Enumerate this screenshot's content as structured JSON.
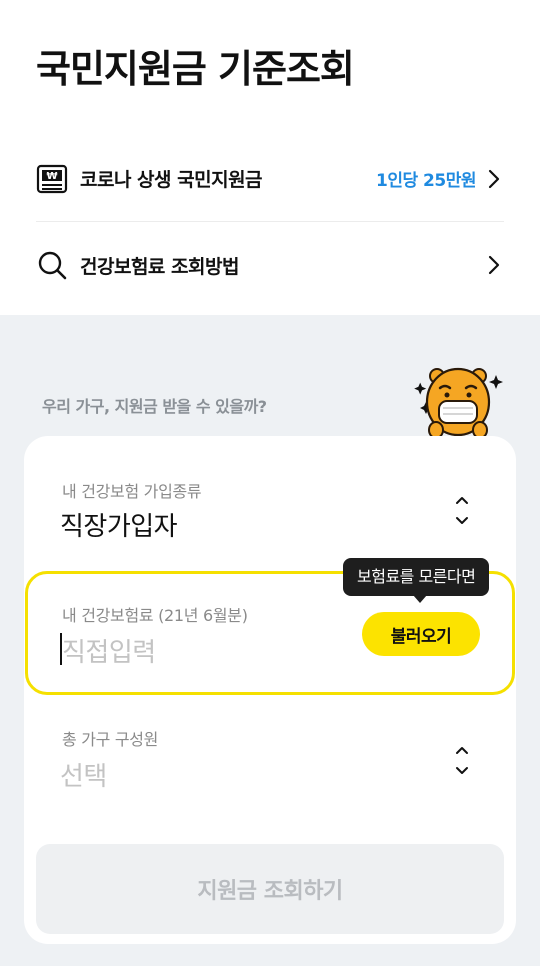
{
  "header": {
    "title": "국민지원금 기준조회"
  },
  "menu": [
    {
      "label": "코로나 상생 국민지원금",
      "badge": "1인당 25만원",
      "icon": "won-card-icon"
    },
    {
      "label": "건강보험료 조회방법",
      "badge": "",
      "icon": "search-icon"
    }
  ],
  "question": "우리 가구, 지원금 받을 수 있을까?",
  "form": {
    "insurance_type": {
      "label": "내 건강보험 가입종류",
      "value": "직장가입자"
    },
    "premium": {
      "label": "내 건강보험료 (21년 6월분)",
      "placeholder": "직접입력",
      "load_button": "불러오기",
      "tooltip": "보험료를 모른다면"
    },
    "household": {
      "label": "총 가구 구성원",
      "placeholder": "선택"
    },
    "submit_label": "지원금 조회하기"
  },
  "colors": {
    "accent_yellow": "#fce300",
    "badge_blue": "#1f8ae0",
    "bg_gray": "#eef1f4"
  }
}
